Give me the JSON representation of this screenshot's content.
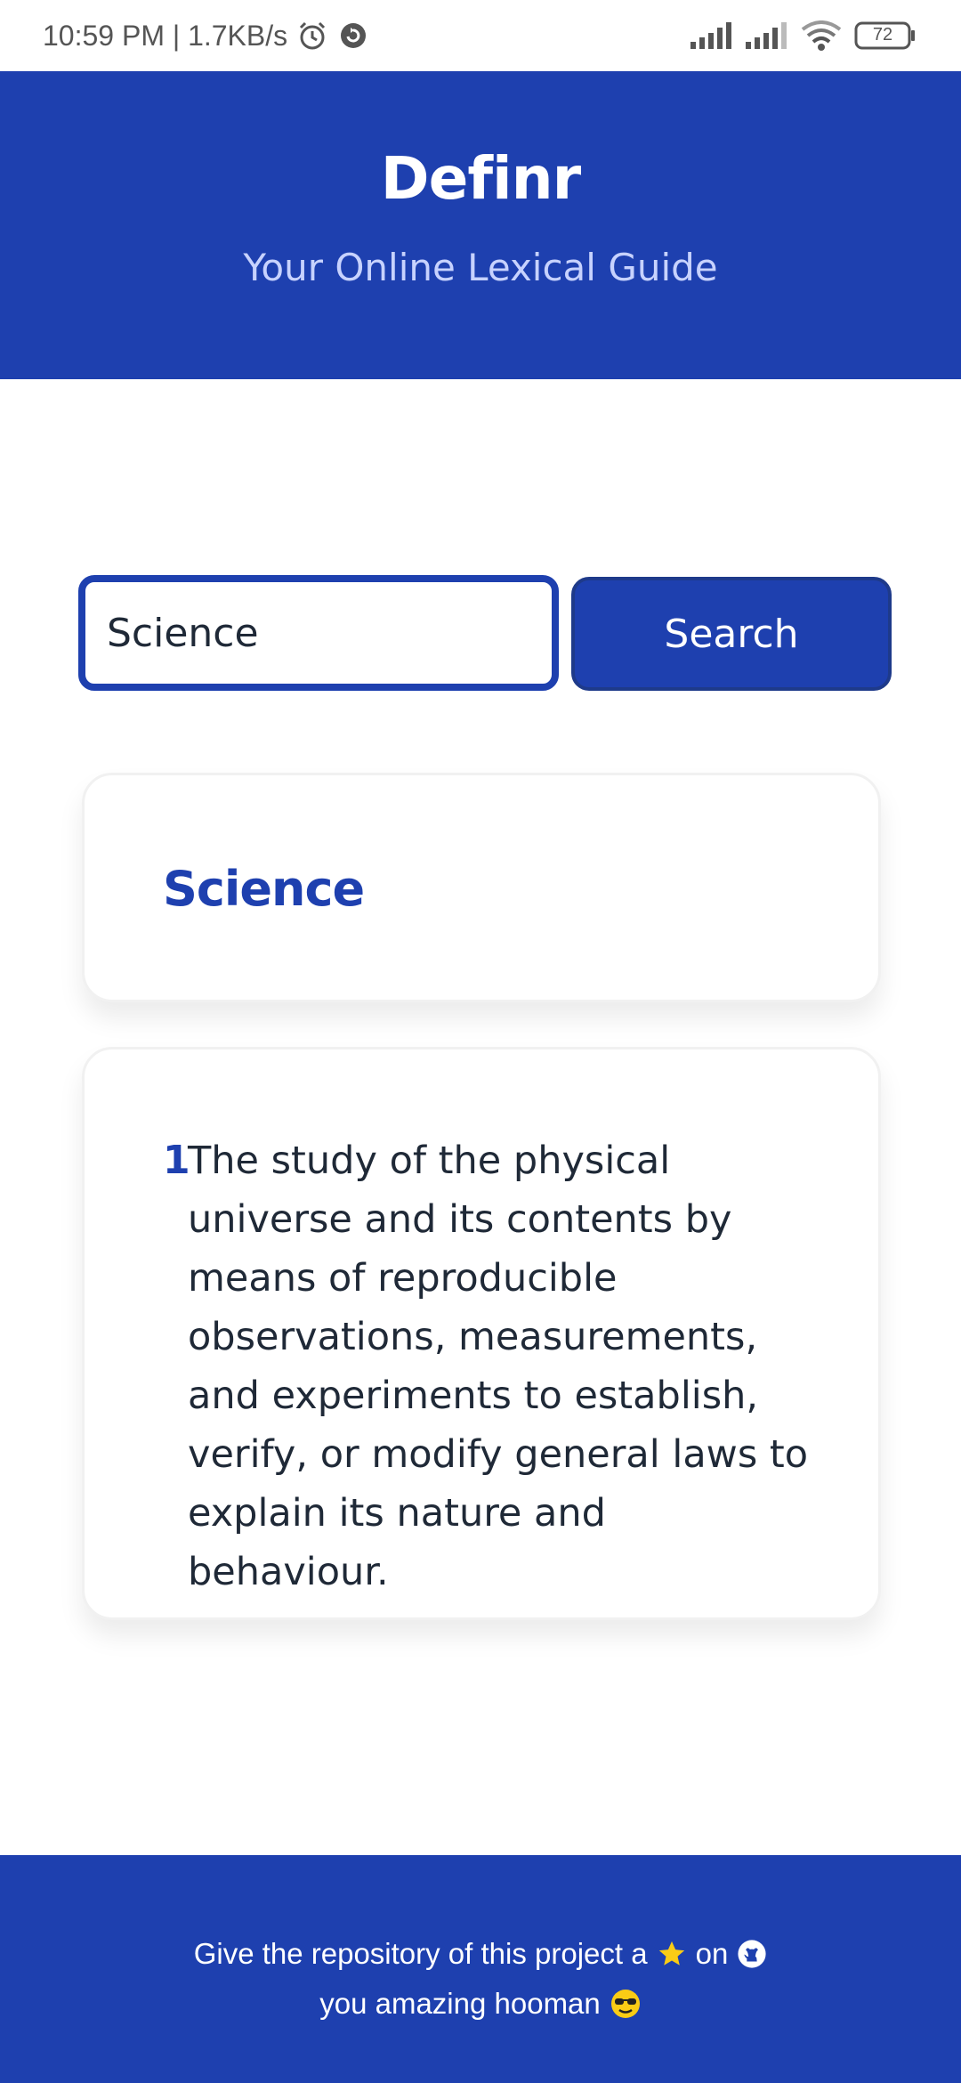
{
  "status_bar": {
    "time_speed": "10:59 PM | 1.7KB/s",
    "battery": "72",
    "icons": [
      "alarm-icon",
      "sync-icon",
      "signal-icon",
      "signal-icon",
      "wifi-icon",
      "battery-icon"
    ]
  },
  "header": {
    "title": "Definr",
    "subtitle": "Your Online Lexical Guide"
  },
  "search": {
    "value": "Science",
    "button_label": "Search"
  },
  "result": {
    "word": "Science",
    "definitions": [
      {
        "number": "1",
        "text": "The study of the physical universe and its contents by means of reproducible observations, measurements, and experiments to establish, verify, or modify general laws to explain its nature and behaviour."
      }
    ]
  },
  "footer": {
    "line1_prefix": "Give the repository of this project a",
    "line1_on": "on",
    "line2": "you amazing hooman",
    "icons": [
      "star-icon",
      "github-icon",
      "sunglasses-emoji-icon"
    ]
  },
  "colors": {
    "primary": "#1e40af",
    "subtitle": "#c7d2fe",
    "text": "#1f2937",
    "star": "#facc15"
  }
}
